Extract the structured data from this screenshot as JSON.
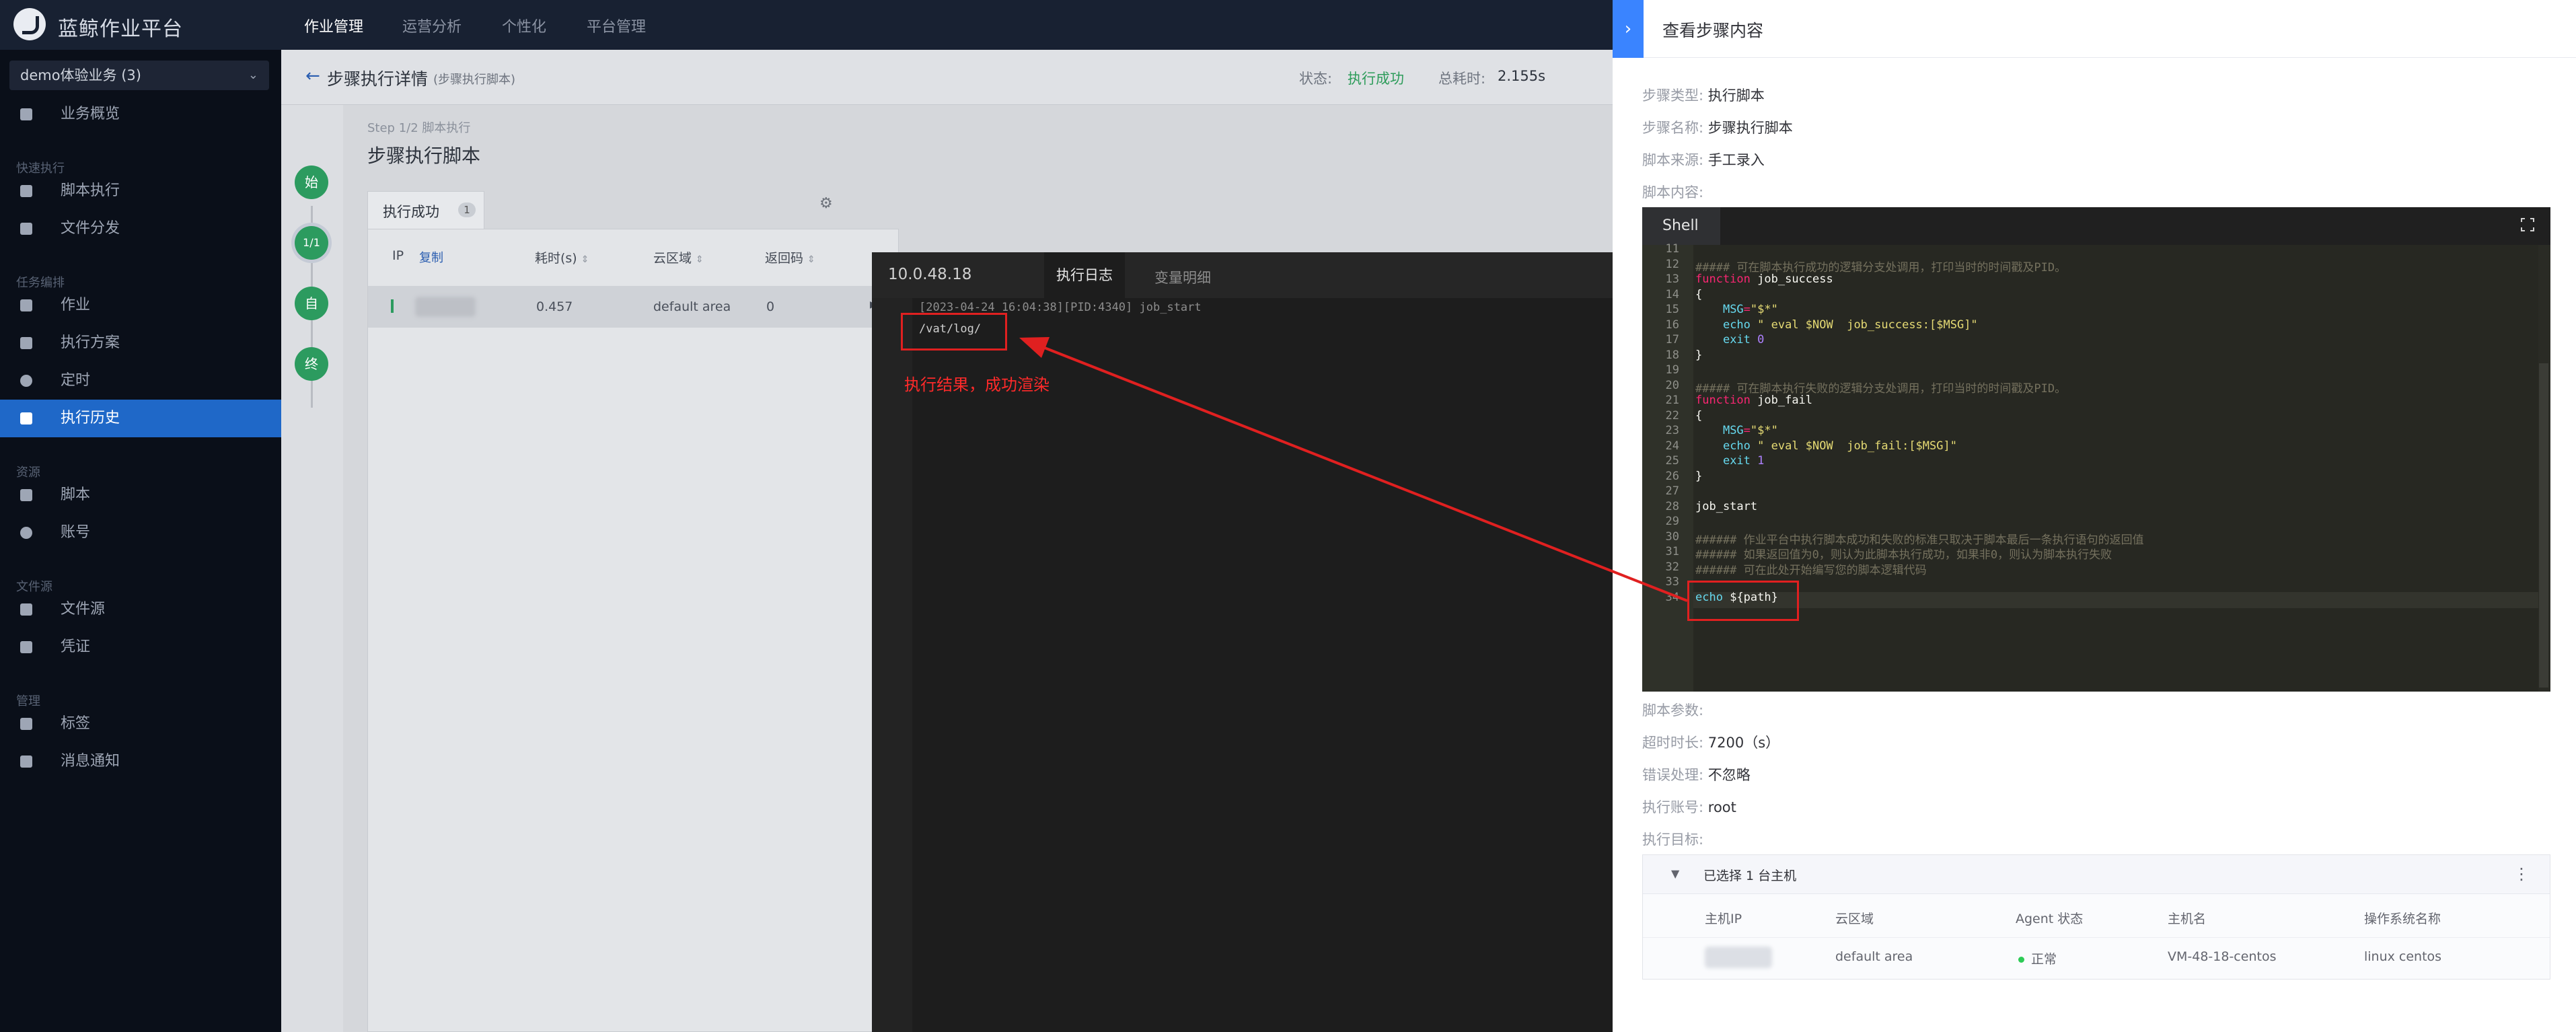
{
  "app": {
    "brand": "蓝鲸作业平台",
    "nav": [
      "作业管理",
      "运营分析",
      "个性化",
      "平台管理"
    ],
    "accent": "#3a84ff"
  },
  "sidebar": {
    "business": "demo体验业务 (3)",
    "items": [
      {
        "label": "业务概览",
        "icon": "home-icon"
      },
      {
        "group": "快速执行"
      },
      {
        "label": "脚本执行",
        "icon": "script-run-icon"
      },
      {
        "label": "文件分发",
        "icon": "file-dist-icon"
      },
      {
        "group": "任务编排"
      },
      {
        "label": "作业",
        "icon": "job-icon"
      },
      {
        "label": "执行方案",
        "icon": "plan-icon"
      },
      {
        "label": "定时",
        "icon": "clock-icon"
      },
      {
        "label": "执行历史",
        "icon": "history-icon",
        "active": true
      },
      {
        "group": "资源"
      },
      {
        "label": "脚本",
        "icon": "script-icon"
      },
      {
        "label": "账号",
        "icon": "account-icon"
      },
      {
        "group": "文件源"
      },
      {
        "label": "文件源",
        "icon": "folder-icon"
      },
      {
        "label": "凭证",
        "icon": "credential-icon"
      },
      {
        "group": "管理"
      },
      {
        "label": "标签",
        "icon": "tag-icon"
      },
      {
        "label": "消息通知",
        "icon": "bell-icon"
      }
    ]
  },
  "header": {
    "title": "步骤执行详情",
    "subtitle": "(步骤执行脚本)",
    "status_label": "状态:",
    "status_value": "执行成功",
    "total_label": "总耗时:",
    "total_value": "2.155s"
  },
  "steps": [
    "始",
    "1/1",
    "自",
    "终"
  ],
  "step": {
    "no": "Step 1/2 脚本执行",
    "title": "步骤执行脚本",
    "tab_label": "执行成功",
    "tab_count": "1"
  },
  "table": {
    "headers": {
      "ip": "IP",
      "copy": "复制",
      "time": "耗时(s)",
      "cloud": "云区域",
      "code": "返回码"
    },
    "row": {
      "time": "0.457",
      "cloud": "default area",
      "code": "0"
    }
  },
  "log": {
    "ip": "10.0.48.18",
    "tabs": [
      "执行日志",
      "变量明细"
    ],
    "lines": [
      "[2023-04-24 16:04:38][PID:4340] job_start",
      "/vat/log/"
    ],
    "annotation": "执行结果，成功渲染"
  },
  "drawer": {
    "title": "查看步骤内容",
    "fields": [
      {
        "k": "步骤类型:",
        "v": "执行脚本"
      },
      {
        "k": "步骤名称:",
        "v": "步骤执行脚本"
      },
      {
        "k": "脚本来源:",
        "v": "手工录入"
      },
      {
        "k": "脚本内容:",
        "v": ""
      }
    ],
    "editor_tab": "Shell",
    "fields2": [
      {
        "k": "脚本参数:",
        "v": ""
      },
      {
        "k": "超时时长:",
        "v": "7200（s）"
      },
      {
        "k": "错误处理:",
        "v": "不忽略"
      },
      {
        "k": "执行账号:",
        "v": "root"
      },
      {
        "k": "执行目标:",
        "v": ""
      }
    ],
    "hosts": {
      "title": "已选择 1 台主机",
      "headers": [
        "主机IP",
        "云区域",
        "Agent 状态",
        "主机名",
        "操作系统名称"
      ],
      "row": {
        "cloud": "default area",
        "agent": "正常",
        "hostname": "VM-48-18-centos",
        "os": "linux centos"
      }
    }
  },
  "code_lines": [
    {
      "n": "11",
      "t": ""
    },
    {
      "n": "12",
      "t": "##### 可在脚本执行成功的逻辑分支处调用，打印当时的时间戳及PID。"
    },
    {
      "n": "13",
      "t": "function job_success"
    },
    {
      "n": "14",
      "t": "{"
    },
    {
      "n": "15",
      "t": "    MSG=\"$*\""
    },
    {
      "n": "16",
      "t": "    echo \" eval $NOW  job_success:[$MSG]\""
    },
    {
      "n": "17",
      "t": "    exit 0"
    },
    {
      "n": "18",
      "t": "}"
    },
    {
      "n": "19",
      "t": ""
    },
    {
      "n": "20",
      "t": "##### 可在脚本执行失败的逻辑分支处调用，打印当时的时间戳及PID。"
    },
    {
      "n": "21",
      "t": "function job_fail"
    },
    {
      "n": "22",
      "t": "{"
    },
    {
      "n": "23",
      "t": "    MSG=\"$*\""
    },
    {
      "n": "24",
      "t": "    echo \" eval $NOW  job_fail:[$MSG]\""
    },
    {
      "n": "25",
      "t": "    exit 1"
    },
    {
      "n": "26",
      "t": "}"
    },
    {
      "n": "27",
      "t": ""
    },
    {
      "n": "28",
      "t": "job_start"
    },
    {
      "n": "29",
      "t": ""
    },
    {
      "n": "30",
      "t": "###### 作业平台中执行脚本成功和失败的标准只取决于脚本最后一条执行语句的返回值"
    },
    {
      "n": "31",
      "t": "###### 如果返回值为0，则认为此脚本执行成功，如果非0，则认为脚本执行失败"
    },
    {
      "n": "32",
      "t": "###### 可在此处开始编写您的脚本逻辑代码"
    },
    {
      "n": "33",
      "t": ""
    },
    {
      "n": "34",
      "t": "echo ${path}"
    }
  ]
}
